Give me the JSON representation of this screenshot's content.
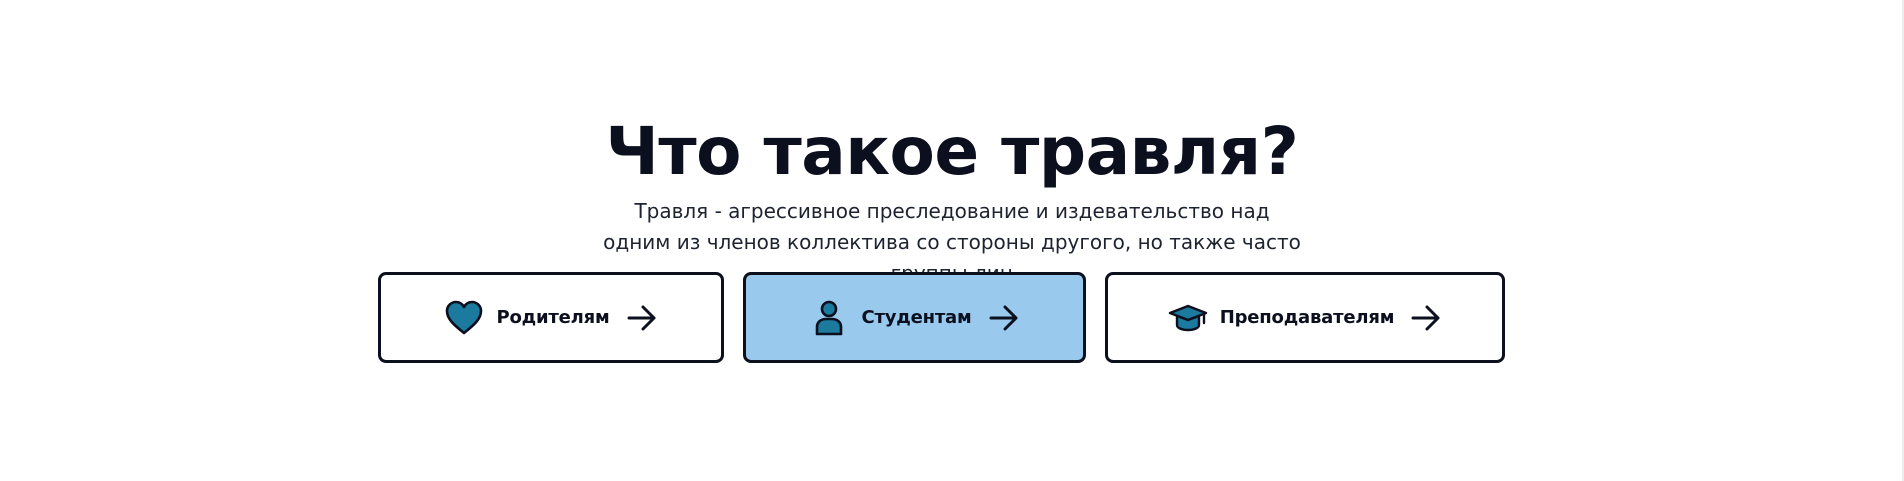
{
  "hero": {
    "title": "Что такое травля?",
    "subtitle": "Травля - агрессивное преследование и издевательство над одним из членов коллектива со стороны другого, но также часто группы лиц"
  },
  "cards": [
    {
      "label": "Родителям",
      "icon": "heart-icon",
      "active": false
    },
    {
      "label": "Студентам",
      "icon": "user-icon",
      "active": true
    },
    {
      "label": "Преподавателям",
      "icon": "graduation-cap-icon",
      "active": false
    }
  ],
  "colors": {
    "accent_icon": "#1b7a9e",
    "active_card_bg": "#99caee",
    "text_dark": "#0b0f1e"
  }
}
